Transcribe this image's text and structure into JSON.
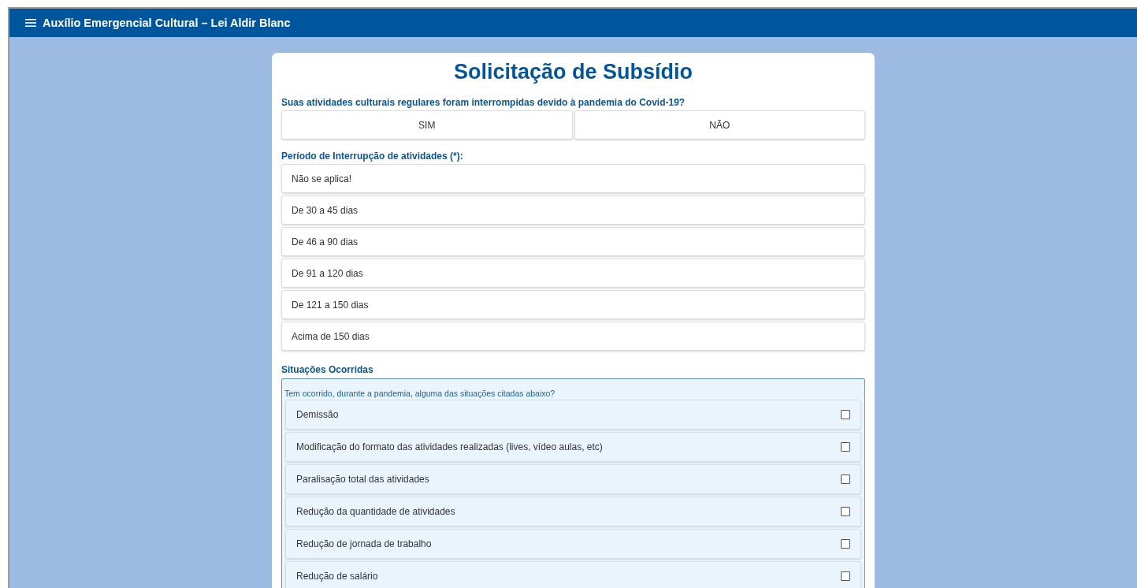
{
  "app_bar": {
    "title": "Auxílio Emergencial Cultural – Lei Aldir Blanc"
  },
  "form": {
    "title": "Solicitação de Subsídio",
    "question": {
      "label": "Suas atividades culturais regulares foram interrompidas devido à pandemia do Covid-19?",
      "options": [
        {
          "label": "SIM",
          "selected": false
        },
        {
          "label": "NÃO",
          "selected": false
        }
      ]
    },
    "period": {
      "label": "Período de Interrupção de atividades (*):",
      "options": [
        {
          "label": "Não se aplica!",
          "selected": false
        },
        {
          "label": "De 30 a 45 dias",
          "selected": false
        },
        {
          "label": "De 46 a 90 dias",
          "selected": false
        },
        {
          "label": "De 91 a 120 dias",
          "selected": false
        },
        {
          "label": "De 121 a 150 dias",
          "selected": false
        },
        {
          "label": "Acima de 150 dias",
          "selected": false
        }
      ]
    },
    "situations": {
      "label": "Situações Ocorridas",
      "hint": "Tem ocorrido, durante a pandemia, alguma das situações citadas abaixo?",
      "items": [
        {
          "label": "Demissão",
          "checked": false
        },
        {
          "label": "Modificação do formato das atividades realizadas (lives, vídeo aulas, etc)",
          "checked": false
        },
        {
          "label": "Paralisação total das atividades",
          "checked": false
        },
        {
          "label": "Redução da quantidade de atividades",
          "checked": false
        },
        {
          "label": "Redução de jornada de trabalho",
          "checked": false
        },
        {
          "label": "Redução de salário",
          "checked": false
        }
      ]
    }
  }
}
